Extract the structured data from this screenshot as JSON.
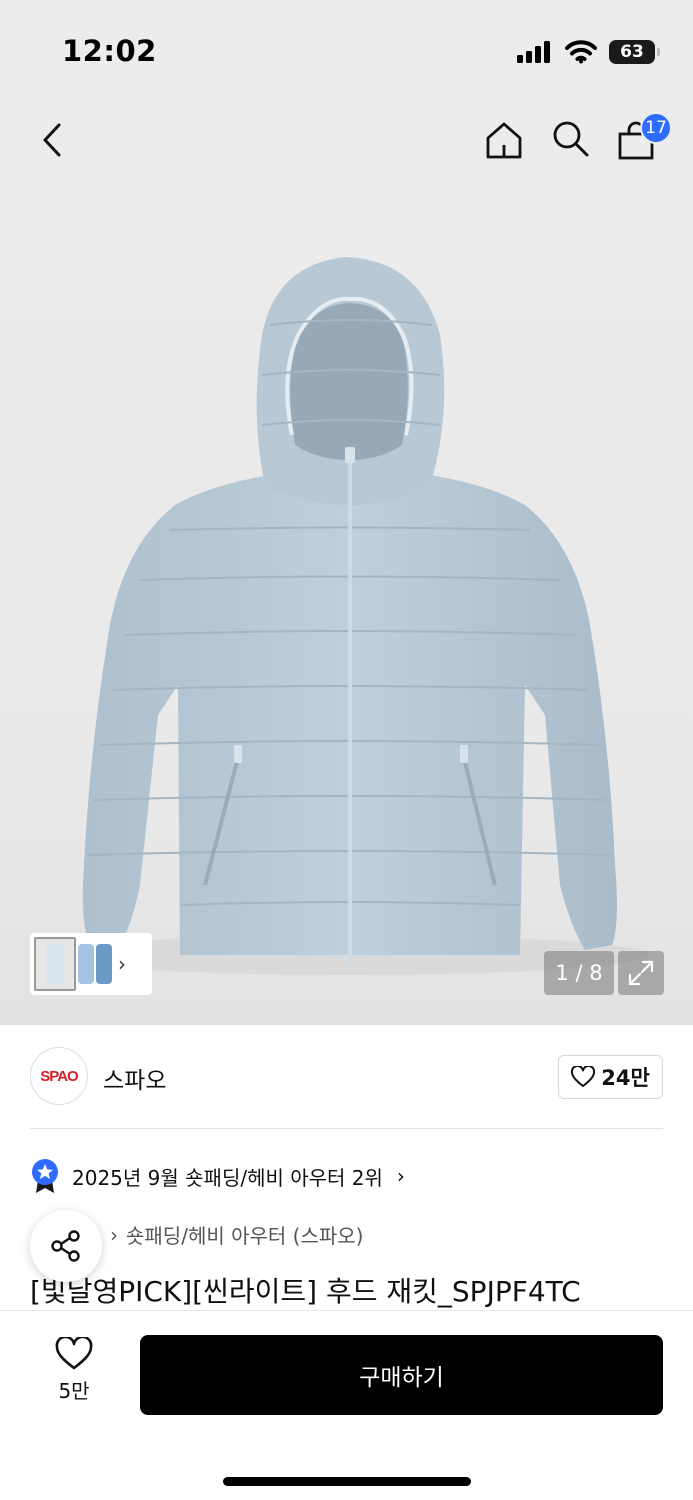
{
  "status_bar": {
    "time": "12:02",
    "battery": "63"
  },
  "nav": {
    "cart_count": "17"
  },
  "gallery": {
    "counter": "1 / 8",
    "jacket_color": "#b9c9d6"
  },
  "brand": {
    "logo_text": "SPAO",
    "name": "스파오",
    "likes": "24만"
  },
  "ranking": {
    "text": "2025년 9월 숏패딩/헤비 아우터 2위"
  },
  "category": {
    "path": "숏패딩/헤비 아우터 (스파오)"
  },
  "product": {
    "title": "[빛날영PICK][씬라이트] 후드 재킷_SPJPF4TC"
  },
  "bottom_bar": {
    "wish_count": "5만",
    "buy_label": "구매하기"
  },
  "colors": {
    "accent": "#2f6bff",
    "brand_red": "#d51f26",
    "buy_bg": "#000000"
  }
}
